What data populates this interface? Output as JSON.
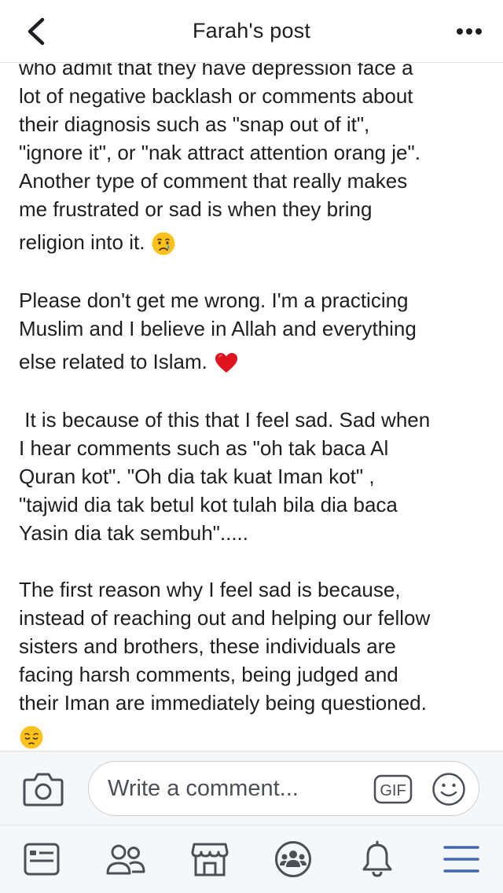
{
  "header": {
    "title": "Farah's post",
    "back_icon": "chevron-left-icon",
    "more_icon": "more-dots-icon"
  },
  "post": {
    "paragraphs": [
      {
        "lines": [
          "who admit that they have depression face a",
          "lot of negative backlash or comments about",
          "their diagnosis such as \"snap out of it\",",
          "\"ignore it\", or \"nak attract attention orang je\".",
          "Another type of comment that really makes",
          "me frustrated or sad is when they bring"
        ],
        "last_line": "religion into it.",
        "emoji": "crying-face-icon"
      },
      {
        "lines": [
          "Please don't get me wrong. I'm a practicing",
          "Muslim and I believe in Allah and everything"
        ],
        "last_line": "else related to Islam.",
        "emoji": "red-heart-icon"
      },
      {
        "lines": [
          " It is because of this that I feel sad. Sad when",
          "I hear comments such as \"oh tak baca Al",
          "Quran kot\". \"Oh dia tak kuat Iman kot\" ,",
          "\"tajwid dia tak betul kot tulah bila dia baca",
          "Yasin dia tak sembuh\"....."
        ]
      },
      {
        "lines": [
          "The first reason why I feel sad is because,",
          "instead of reaching out and helping our fellow",
          "sisters and brothers, these individuals are",
          "facing harsh comments, being judged and",
          "their Iman are immediately being questioned."
        ],
        "last_line": "",
        "emoji": "pensive-face-icon"
      }
    ]
  },
  "comment_bar": {
    "placeholder": "Write a comment...",
    "gif_label": "GIF",
    "camera_icon": "camera-icon",
    "emoji_icon": "smiley-icon"
  },
  "tabbar": {
    "items": [
      {
        "name": "tab-news-feed",
        "icon": "news-feed-icon",
        "active": false
      },
      {
        "name": "tab-friends",
        "icon": "friends-icon",
        "active": false
      },
      {
        "name": "tab-marketplace",
        "icon": "marketplace-icon",
        "active": false
      },
      {
        "name": "tab-groups",
        "icon": "groups-icon",
        "active": false
      },
      {
        "name": "tab-notifications",
        "icon": "bell-icon",
        "active": false
      },
      {
        "name": "tab-menu",
        "icon": "menu-icon",
        "active": true
      }
    ]
  },
  "colors": {
    "text": "#1c1e21",
    "icon": "#4b4f56",
    "active": "#4267b2",
    "bar_bg": "#f6f7f9",
    "border": "#dddfe2"
  }
}
